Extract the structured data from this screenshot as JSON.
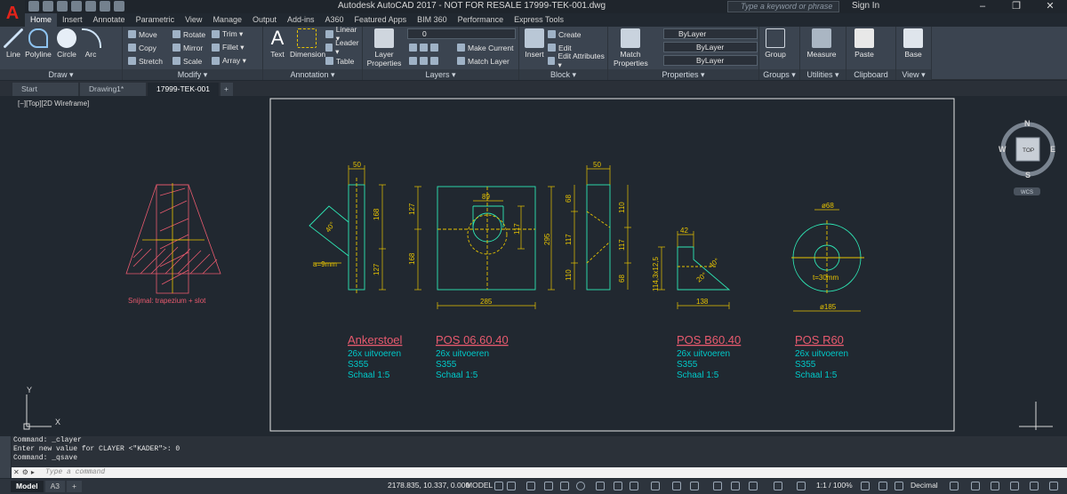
{
  "app": {
    "logo": "A",
    "title": "Autodesk AutoCAD 2017 - NOT FOR RESALE    17999-TEK-001.dwg",
    "search_placeholder": "Type a keyword or phrase",
    "signin": "Sign In"
  },
  "ribbon_tabs": [
    "Home",
    "Insert",
    "Annotate",
    "Parametric",
    "View",
    "Manage",
    "Output",
    "Add-ins",
    "A360",
    "Featured Apps",
    "BIM 360",
    "Performance",
    "Express Tools"
  ],
  "ribbon": {
    "draw": {
      "label": "Draw ▾",
      "line": "Line",
      "polyline": "Polyline",
      "circle": "Circle",
      "arc": "Arc"
    },
    "modify": {
      "label": "Modify ▾",
      "move": "Move",
      "rotate": "Rotate",
      "trim": "Trim ▾",
      "copy": "Copy",
      "mirror": "Mirror",
      "fillet": "Fillet ▾",
      "stretch": "Stretch",
      "scale": "Scale",
      "array": "Array ▾"
    },
    "annotation": {
      "label": "Annotation ▾",
      "text": "Text",
      "dimension": "Dimension",
      "linear": "Linear ▾",
      "leader": "Leader ▾",
      "table": "Table"
    },
    "layers": {
      "label": "Layers ▾",
      "props1": "Layer",
      "props2": "Properties",
      "current_layer": "0",
      "make_current": "Make Current",
      "match_layer": "Match Layer"
    },
    "block": {
      "label": "Block ▾",
      "insert": "Insert",
      "create": "Create",
      "edit": "Edit",
      "edit_attr": "Edit Attributes ▾"
    },
    "properties": {
      "label": "Properties ▾",
      "match1": "Match",
      "match2": "Properties",
      "color": "ByLayer",
      "linetype": "ByLayer",
      "lineweight": "ByLayer"
    },
    "groups": {
      "label": "Groups ▾",
      "group": "Group"
    },
    "utilities": {
      "label": "Utilities ▾",
      "measure": "Measure"
    },
    "clipboard": {
      "label": "Clipboard",
      "paste": "Paste"
    },
    "view": {
      "label": "View ▾",
      "base": "Base"
    }
  },
  "doc_tabs": [
    "Start",
    "Drawing1*",
    "17999-TEK-001"
  ],
  "viewport_label": "[−][Top][2D Wireframe]",
  "viewcube": {
    "n": "N",
    "s": "S",
    "e": "E",
    "w": "W",
    "top": "TOP",
    "wcs": "WCS"
  },
  "drawing": {
    "snijmal": "Snijmal: trapezium + slot",
    "parts": [
      {
        "title": "Ankerstoel",
        "qty": "26x uitvoeren",
        "steel": "S355",
        "scale": "Schaal 1:5"
      },
      {
        "title": "POS 06.60.40",
        "qty": "26x uitvoeren",
        "steel": "S355",
        "scale": "Schaal 1:5"
      },
      {
        "title": "POS B60.40",
        "qty": "26x uitvoeren",
        "steel": "S355",
        "scale": "Schaal 1:5"
      },
      {
        "title": "POS R60",
        "qty": "26x uitvoeren",
        "steel": "S355",
        "scale": "Schaal 1:5"
      }
    ],
    "dims": {
      "d50a": "50",
      "d168": "168",
      "d127": "127",
      "d40": "40°",
      "a9": "a=9mm",
      "d89": "89",
      "d127b": "127",
      "d117": "117",
      "d295": "295",
      "d168b": "168",
      "d285": "285",
      "d50b": "50",
      "d68": "68",
      "d110": "110",
      "d117b": "117",
      "d117c": "117",
      "d110b": "110",
      "d68b": "68",
      "d42": "42",
      "d114": "114,3x12,5",
      "d40b": "40°",
      "d20": "20°",
      "d138": "138",
      "dia68": "ø68",
      "t30": "t=30mm",
      "dia185": "ø185"
    },
    "ucs": {
      "x": "X",
      "y": "Y"
    }
  },
  "command": {
    "line1": "Command: _clayer",
    "line2": "Enter new value for CLAYER <\"KADER\">: 0",
    "line3": "Command: _qsave",
    "placeholder": "Type a command"
  },
  "status": {
    "tabs": [
      "Model",
      "A3"
    ],
    "coords": "2178.835, 10.337, 0.000",
    "model": "MODEL",
    "scale": "1:1 / 100%",
    "units": "Decimal"
  },
  "colors": {
    "dim": "#e8c400",
    "geom": "#2ee6b4",
    "red": "#e85a6e",
    "frame": "#e8e8e8",
    "cyan": "#00c8c8"
  }
}
